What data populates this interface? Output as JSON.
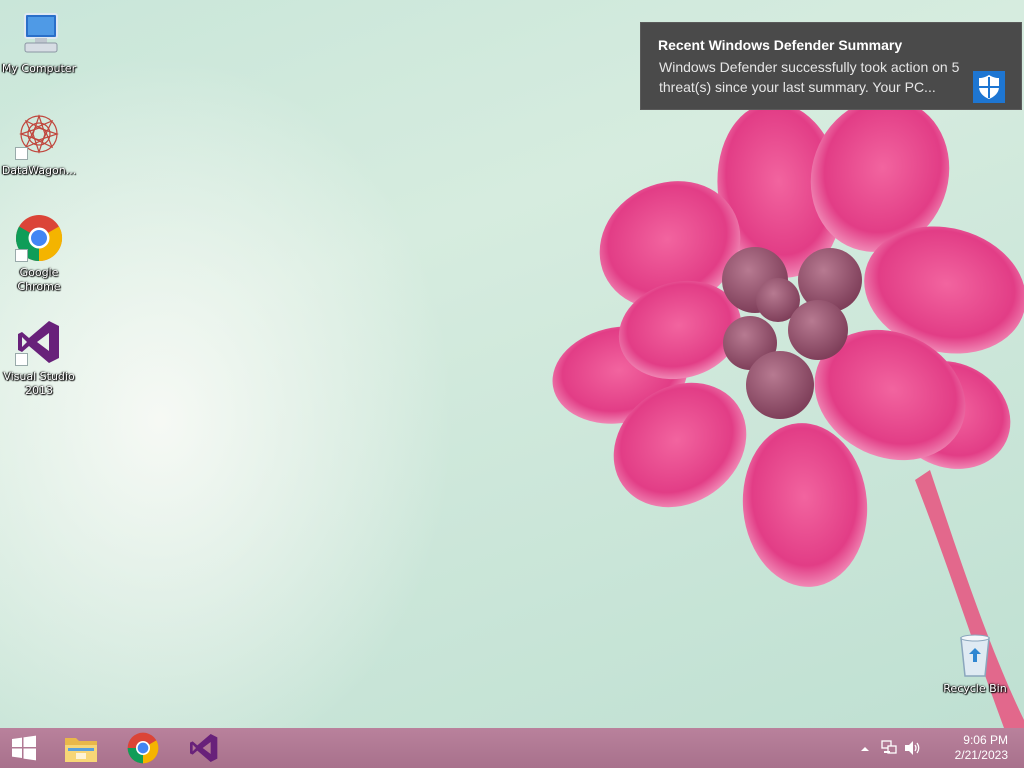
{
  "desktop": {
    "icons": [
      {
        "label": "My Computer"
      },
      {
        "label": "DataWagon..."
      },
      {
        "label": "Google\nChrome"
      },
      {
        "label": "Visual Studio\n2013"
      },
      {
        "label": "Recycle Bin"
      }
    ]
  },
  "notification": {
    "title": "Recent Windows Defender Summary",
    "body": "Windows Defender successfully took action on 5 threat(s) since your last summary. Your PC...",
    "icon": "shield-icon",
    "accent": "#1e76d2"
  },
  "taskbar": {
    "pinned": [
      {
        "name": "start-icon"
      },
      {
        "name": "file-explorer-icon"
      },
      {
        "name": "chrome-icon"
      },
      {
        "name": "visual-studio-icon"
      }
    ],
    "tray": {
      "icons": [
        "show-hidden-icons",
        "network-icon",
        "volume-icon"
      ],
      "time": "9:06 PM",
      "date": "2/21/2023"
    },
    "color": "#b07892"
  }
}
